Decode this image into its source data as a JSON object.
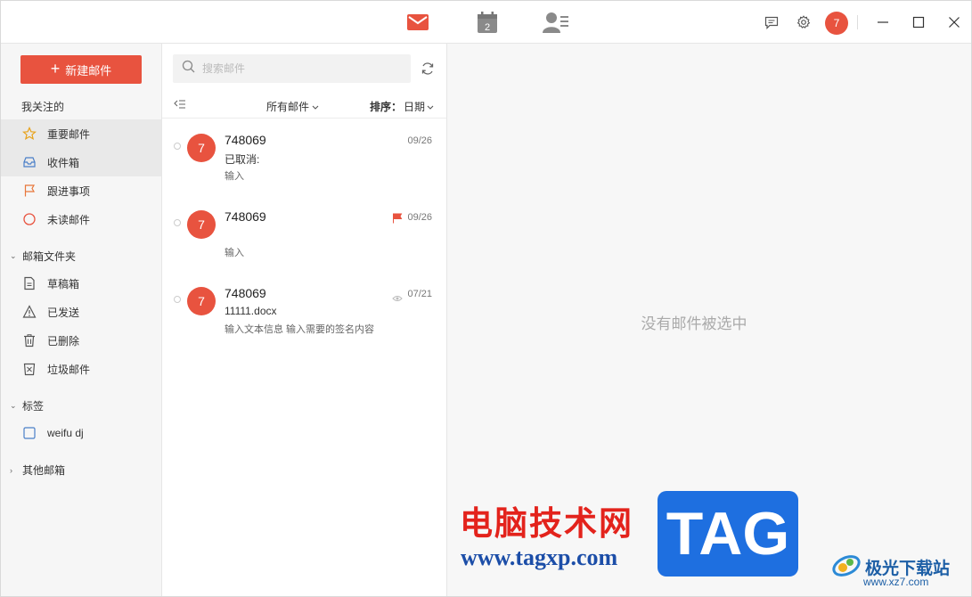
{
  "colors": {
    "accent": "#e8533f",
    "sidebar_bg": "#f6f6f6",
    "pane_bg": "#f7f7f7"
  },
  "topbar": {
    "calendar_day": "2",
    "user_avatar": "7",
    "icons": [
      "mail-icon",
      "calendar-icon",
      "contacts-icon",
      "chat-icon",
      "gear-icon",
      "minimize-icon",
      "maximize-icon",
      "close-icon"
    ]
  },
  "sidebar": {
    "compose_label": "新建邮件",
    "section_followed": "我关注的",
    "followed_items": [
      {
        "label": "重要邮件",
        "icon": "star-icon"
      },
      {
        "label": "收件箱",
        "icon": "inbox-icon"
      },
      {
        "label": "跟进事项",
        "icon": "flag-icon"
      },
      {
        "label": "未读邮件",
        "icon": "circle-icon"
      }
    ],
    "section_folders": "邮箱文件夹",
    "folder_items": [
      {
        "label": "草稿箱",
        "icon": "draft-icon"
      },
      {
        "label": "已发送",
        "icon": "sent-icon"
      },
      {
        "label": "已删除",
        "icon": "trash-icon"
      },
      {
        "label": "垃圾邮件",
        "icon": "spam-icon"
      }
    ],
    "section_tags": "标签",
    "tag_items": [
      {
        "label": "weifu dj",
        "icon": "tag-checkbox-icon"
      }
    ],
    "section_other": "其他邮箱"
  },
  "list": {
    "search_placeholder": "搜索邮件",
    "filter_label": "所有邮件",
    "sort_prefix": "排序：",
    "sort_value": "日期",
    "mails": [
      {
        "avatar": "7",
        "sender": "748069",
        "date": "09/26",
        "subject": "已取消:",
        "preview": "输入",
        "marker": "none"
      },
      {
        "avatar": "7",
        "sender": "748069",
        "date": "09/26",
        "subject": "",
        "preview": "输入",
        "marker": "flag"
      },
      {
        "avatar": "7",
        "sender": "748069",
        "date": "07/21",
        "subject": "11111.docx",
        "preview": "输入文本信息 输入需要的签名内容",
        "marker": "eye"
      }
    ]
  },
  "pane": {
    "empty_text": "没有邮件被选中"
  },
  "watermark": {
    "site_cn": "电脑技术网",
    "site_url": "www.tagxp.com",
    "tag": "TAG",
    "brand_cn": "极光下载站",
    "brand_url": "www.xz7.com"
  }
}
